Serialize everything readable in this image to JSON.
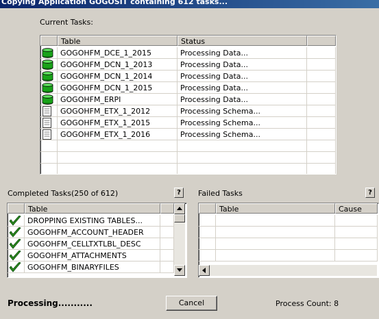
{
  "window": {
    "title": "Copying Application GOGOSIT containing 612 tasks..."
  },
  "current": {
    "label": "Current Tasks:",
    "columns": [
      "Table",
      "Status"
    ],
    "rows": [
      {
        "icon": "database-icon",
        "table": "GOGOHFM_DCE_1_2015",
        "status": "Processing Data..."
      },
      {
        "icon": "database-icon",
        "table": "GOGOHFM_DCN_1_2013",
        "status": "Processing Data..."
      },
      {
        "icon": "database-icon",
        "table": "GOGOHFM_DCN_1_2014",
        "status": "Processing Data..."
      },
      {
        "icon": "database-icon",
        "table": "GOGOHFM_DCN_1_2015",
        "status": "Processing Data..."
      },
      {
        "icon": "database-icon",
        "table": "GOGOHFM_ERPI",
        "status": "Processing Data..."
      },
      {
        "icon": "document-icon",
        "table": "GOGOHFM_ETX_1_2012",
        "status": "Processing Schema..."
      },
      {
        "icon": "document-icon",
        "table": "GOGOHFM_ETX_1_2015",
        "status": "Processing Schema..."
      },
      {
        "icon": "document-icon",
        "table": "GOGOHFM_ETX_1_2016",
        "status": "Processing Schema..."
      }
    ]
  },
  "completed": {
    "label": "Completed Tasks(250 of 612)",
    "help": "?",
    "columns": [
      "Table"
    ],
    "rows": [
      {
        "icon": "check-icon",
        "table": "DROPPING EXISTING TABLES..."
      },
      {
        "icon": "check-icon",
        "table": "GOGOHFM_ACCOUNT_HEADER"
      },
      {
        "icon": "check-icon",
        "table": "GOGOHFM_CELLTXTLBL_DESC"
      },
      {
        "icon": "check-icon",
        "table": "GOGOHFM_ATTACHMENTS"
      },
      {
        "icon": "check-icon",
        "table": "GOGOHFM_BINARYFILES"
      }
    ]
  },
  "failed": {
    "label": "Failed Tasks",
    "help": "?",
    "columns": [
      "Table",
      "Cause"
    ]
  },
  "footer": {
    "status": "Processing...........",
    "cancel": "Cancel",
    "count": "Process Count: 8"
  },
  "colors": {
    "title_bar": "#0a246a",
    "window": "#d4d0c8",
    "db_green": "#19a319",
    "check_green": "#2c8a1e"
  }
}
